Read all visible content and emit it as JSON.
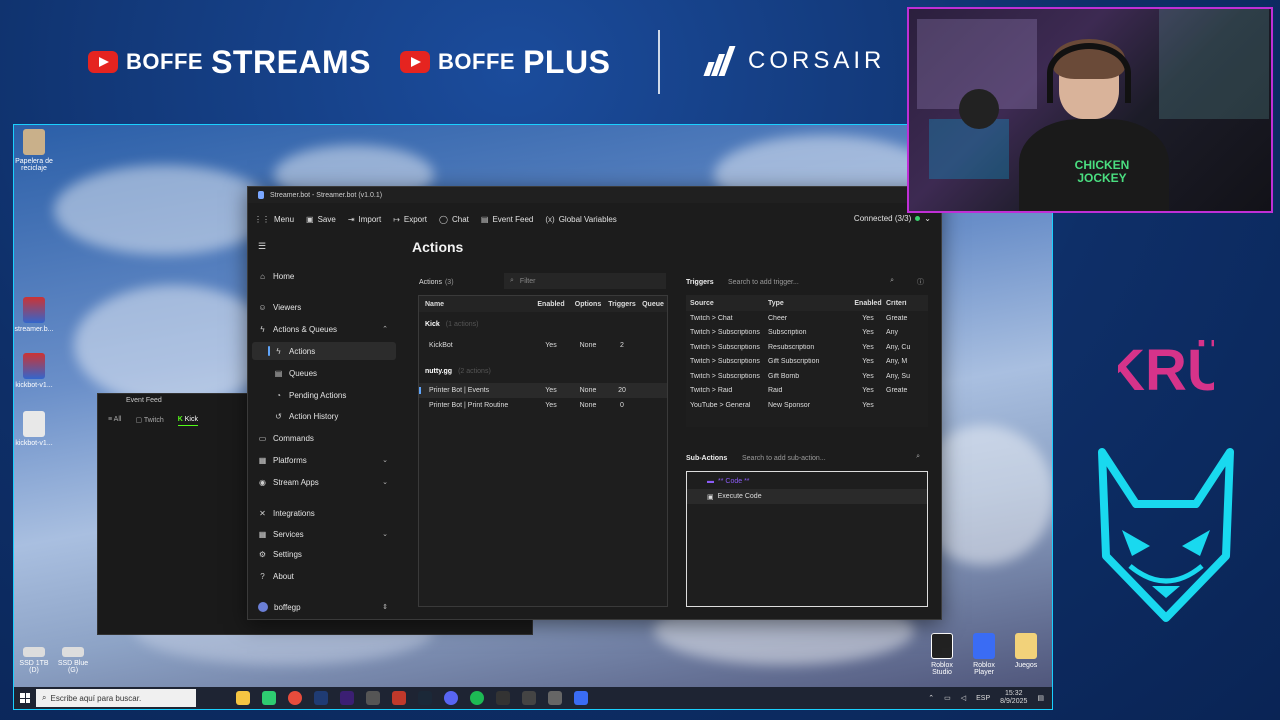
{
  "overlay": {
    "brand1_small": "BOFFE",
    "brand1_big": "STREAMS",
    "brand2_small": "BOFFE",
    "brand2_big": "PLUS",
    "sponsor": "CORSAIR",
    "kru_text": "KRÜ",
    "shirt_text": "CHICKEN JOCKEY"
  },
  "desktop_icons": [
    {
      "label": "Papelera de reciclaje"
    },
    {
      "label": "streamer.b..."
    },
    {
      "label": "kickbot-v1..."
    },
    {
      "label": "kickbot-v1..."
    },
    {
      "label": "SSD 1TB (D)"
    },
    {
      "label": "SSD Blue (G)"
    },
    {
      "label": "Roblox Studio"
    },
    {
      "label": "Roblox Player"
    },
    {
      "label": "Juegos"
    }
  ],
  "taskbar": {
    "search_placeholder": "Escribe aquí para buscar.",
    "lang": "ESP",
    "time": "15:32",
    "date": "8/9/2025"
  },
  "event_feed": {
    "title": "Event Feed",
    "tabs": [
      "All",
      "Twitch",
      "Kick"
    ]
  },
  "window": {
    "title": "Streamer.bot - Streamer.bot (v1.0.1)",
    "menu": [
      {
        "label": "Menu",
        "icon": "grid-icon"
      },
      {
        "label": "Save",
        "icon": "save-icon"
      },
      {
        "label": "Import",
        "icon": "import-icon"
      },
      {
        "label": "Export",
        "icon": "export-icon"
      },
      {
        "label": "Chat",
        "icon": "chat-icon"
      },
      {
        "label": "Event Feed",
        "icon": "feed-icon"
      },
      {
        "label": "Global Variables",
        "icon": "variables-icon"
      }
    ],
    "connected": "Connected (3/3)"
  },
  "sidebar": {
    "items": [
      {
        "label": "Home",
        "icon": "home-icon"
      },
      {
        "label": "Viewers",
        "icon": "viewers-icon"
      },
      {
        "label": "Actions & Queues",
        "icon": "actions-icon"
      },
      {
        "label": "Actions",
        "icon": "action-icon"
      },
      {
        "label": "Queues",
        "icon": "queues-icon"
      },
      {
        "label": "Pending Actions",
        "icon": "pending-icon"
      },
      {
        "label": "Action History",
        "icon": "history-icon"
      },
      {
        "label": "Commands",
        "icon": "commands-icon"
      },
      {
        "label": "Platforms",
        "icon": "platforms-icon"
      },
      {
        "label": "Stream Apps",
        "icon": "stream-apps-icon"
      },
      {
        "label": "Integrations",
        "icon": "integrations-icon"
      },
      {
        "label": "Services",
        "icon": "services-icon"
      },
      {
        "label": "Settings",
        "icon": "settings-icon"
      },
      {
        "label": "About",
        "icon": "about-icon"
      }
    ],
    "user": "boffegp"
  },
  "page_title": "Actions",
  "actions": {
    "label": "Actions",
    "count": "(3)",
    "filter_placeholder": "Filter",
    "columns": [
      "Name",
      "Enabled",
      "Options",
      "Triggers",
      "Queue"
    ],
    "groups": [
      {
        "name": "Kick",
        "sub": "(1 actions)",
        "rows": [
          {
            "name": "KickBot",
            "enabled": "Yes",
            "options": "None",
            "triggers": "2"
          }
        ]
      },
      {
        "name": "nutty.gg",
        "sub": "(2 actions)",
        "rows": [
          {
            "name": "Printer Bot | Events",
            "enabled": "Yes",
            "options": "None",
            "triggers": "20"
          },
          {
            "name": "Printer Bot | Print Routine",
            "enabled": "Yes",
            "options": "None",
            "triggers": "0"
          }
        ]
      }
    ]
  },
  "triggers": {
    "label": "Triggers",
    "search_placeholder": "Search to add trigger...",
    "columns": [
      "Source",
      "Type",
      "Enabled",
      "Criteri"
    ],
    "rows": [
      {
        "source": "Twitch > Chat",
        "type": "Cheer",
        "enabled": "Yes",
        "criteria": "Greate"
      },
      {
        "source": "Twitch > Subscriptions",
        "type": "Subscription",
        "enabled": "Yes",
        "criteria": "Any"
      },
      {
        "source": "Twitch > Subscriptions",
        "type": "Resubscription",
        "enabled": "Yes",
        "criteria": "Any, Cu"
      },
      {
        "source": "Twitch > Subscriptions",
        "type": "Gift Subscription",
        "enabled": "Yes",
        "criteria": "Any, M"
      },
      {
        "source": "Twitch > Subscriptions",
        "type": "Gift Bomb",
        "enabled": "Yes",
        "criteria": "Any, Su"
      },
      {
        "source": "Twitch > Raid",
        "type": "Raid",
        "enabled": "Yes",
        "criteria": "Greate"
      },
      {
        "source": "YouTube > General",
        "type": "New Sponsor",
        "enabled": "Yes",
        "criteria": ""
      }
    ]
  },
  "subactions": {
    "label": "Sub-Actions",
    "search_placeholder": "Search to add sub-action...",
    "items": [
      {
        "label": "** Code **"
      },
      {
        "label": "Execute Code"
      }
    ]
  }
}
